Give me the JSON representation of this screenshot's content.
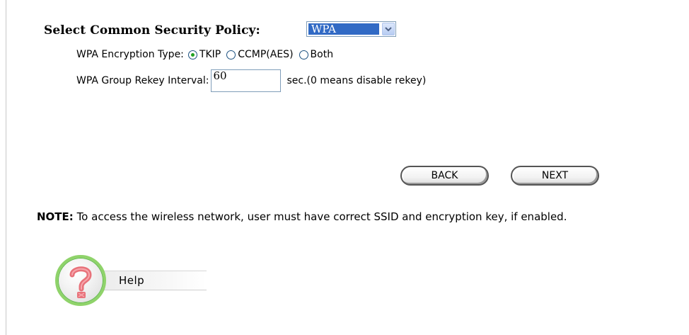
{
  "policy": {
    "label": "Select Common Security Policy:",
    "selected": "WPA"
  },
  "encryption": {
    "label": "WPA Encryption Type:",
    "options": [
      {
        "label": "TKIP",
        "checked": true
      },
      {
        "label": "CCMP(AES)",
        "checked": false
      },
      {
        "label": "Both",
        "checked": false
      }
    ]
  },
  "rekey": {
    "label": "WPA Group Rekey Interval:",
    "value": "60",
    "suffix": "sec.(0 means disable rekey)"
  },
  "buttons": {
    "back": "BACK",
    "next": "NEXT"
  },
  "note": {
    "prefix": "NOTE:",
    "text": " To access the wireless network, user must have correct SSID and encryption key, if enabled."
  },
  "help": {
    "label": "Help",
    "icon": "question-mark-icon",
    "ring_color": "#8fd36a",
    "question_color": "#e8727a"
  },
  "colors": {
    "selection": "#316ac5",
    "radio_dot": "#21a121"
  }
}
